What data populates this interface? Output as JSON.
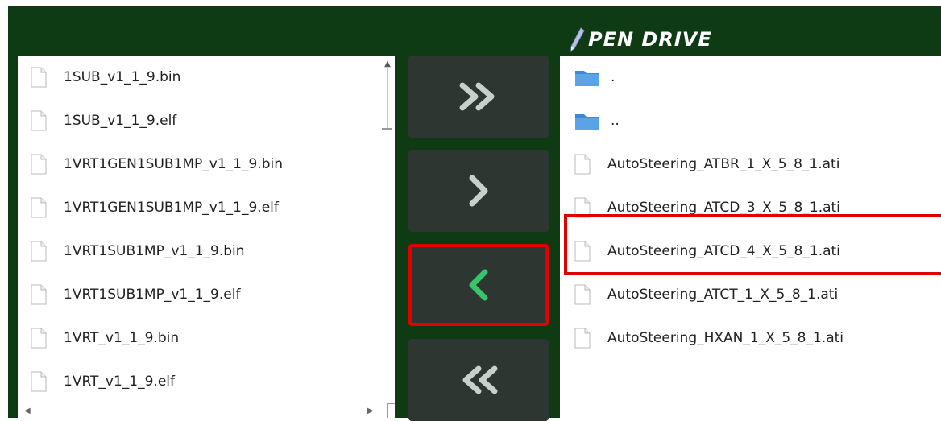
{
  "window": {
    "title": "PEN DRIVE"
  },
  "icons": {
    "title": "pen-icon",
    "file": "file-icon",
    "folder": "folder-icon"
  },
  "colors": {
    "background": "#0e3a14",
    "button": "#2d3630",
    "highlight": "#e00000",
    "folder": "#3a8ad6"
  },
  "left_list": {
    "items": [
      {
        "label": "1SUB_v1_1_9.bin"
      },
      {
        "label": "1SUB_v1_1_9.elf"
      },
      {
        "label": "1VRT1GEN1SUB1MP_v1_1_9.bin"
      },
      {
        "label": "1VRT1GEN1SUB1MP_v1_1_9.elf"
      },
      {
        "label": "1VRT1SUB1MP_v1_1_9.bin"
      },
      {
        "label": "1VRT1SUB1MP_v1_1_9.elf"
      },
      {
        "label": "1VRT_v1_1_9.bin"
      },
      {
        "label": "1VRT_v1_1_9.elf"
      }
    ]
  },
  "buttons": [
    {
      "name": "copy-all-right",
      "icon": "double-chevron-right-icon"
    },
    {
      "name": "copy-right",
      "icon": "chevron-right-icon"
    },
    {
      "name": "copy-left",
      "icon": "chevron-left-icon",
      "highlighted": true
    },
    {
      "name": "copy-all-left",
      "icon": "double-chevron-left-icon"
    }
  ],
  "right_list": {
    "items": [
      {
        "label": ".",
        "type": "folder"
      },
      {
        "label": "..",
        "type": "folder"
      },
      {
        "label": "AutoSteering_ATBR_1_X_5_8_1.ati",
        "type": "file"
      },
      {
        "label": "AutoSteering_ATCD_3_X_5_8_1.ati",
        "type": "file"
      },
      {
        "label": "AutoSteering_ATCD_4_X_5_8_1.ati",
        "type": "file",
        "highlighted": true
      },
      {
        "label": "AutoSteering_ATCT_1_X_5_8_1.ati",
        "type": "file"
      },
      {
        "label": "AutoSteering_HXAN_1_X_5_8_1.ati",
        "type": "file"
      }
    ]
  }
}
